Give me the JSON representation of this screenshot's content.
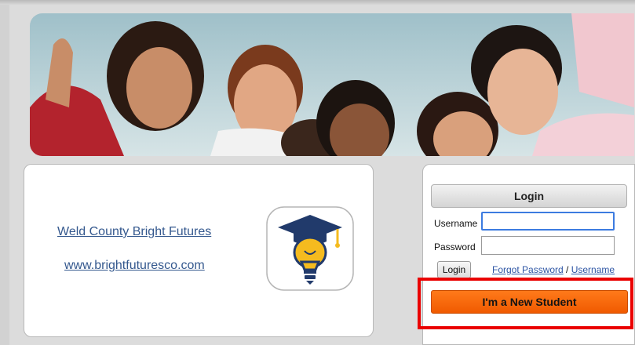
{
  "info": {
    "org_link": "Weld County Bright Futures",
    "site_link": "www.brightfuturesco.com"
  },
  "login": {
    "header": "Login",
    "username_label": "Username",
    "password_label": "Password",
    "username_value": "",
    "password_value": "",
    "login_button": "Login",
    "forgot_password": "Forgot Password",
    "separator": " / ",
    "forgot_username": "Username",
    "new_student_button": "I'm a New Student"
  },
  "icons": {
    "app_icon": "lightbulb-graduation-cap-icon"
  },
  "colors": {
    "accent_orange": "#f26a0a",
    "highlight_red": "#ea0000",
    "link_blue": "#34588e",
    "icon_navy": "#213a6b",
    "icon_gold": "#f5bb1f"
  }
}
